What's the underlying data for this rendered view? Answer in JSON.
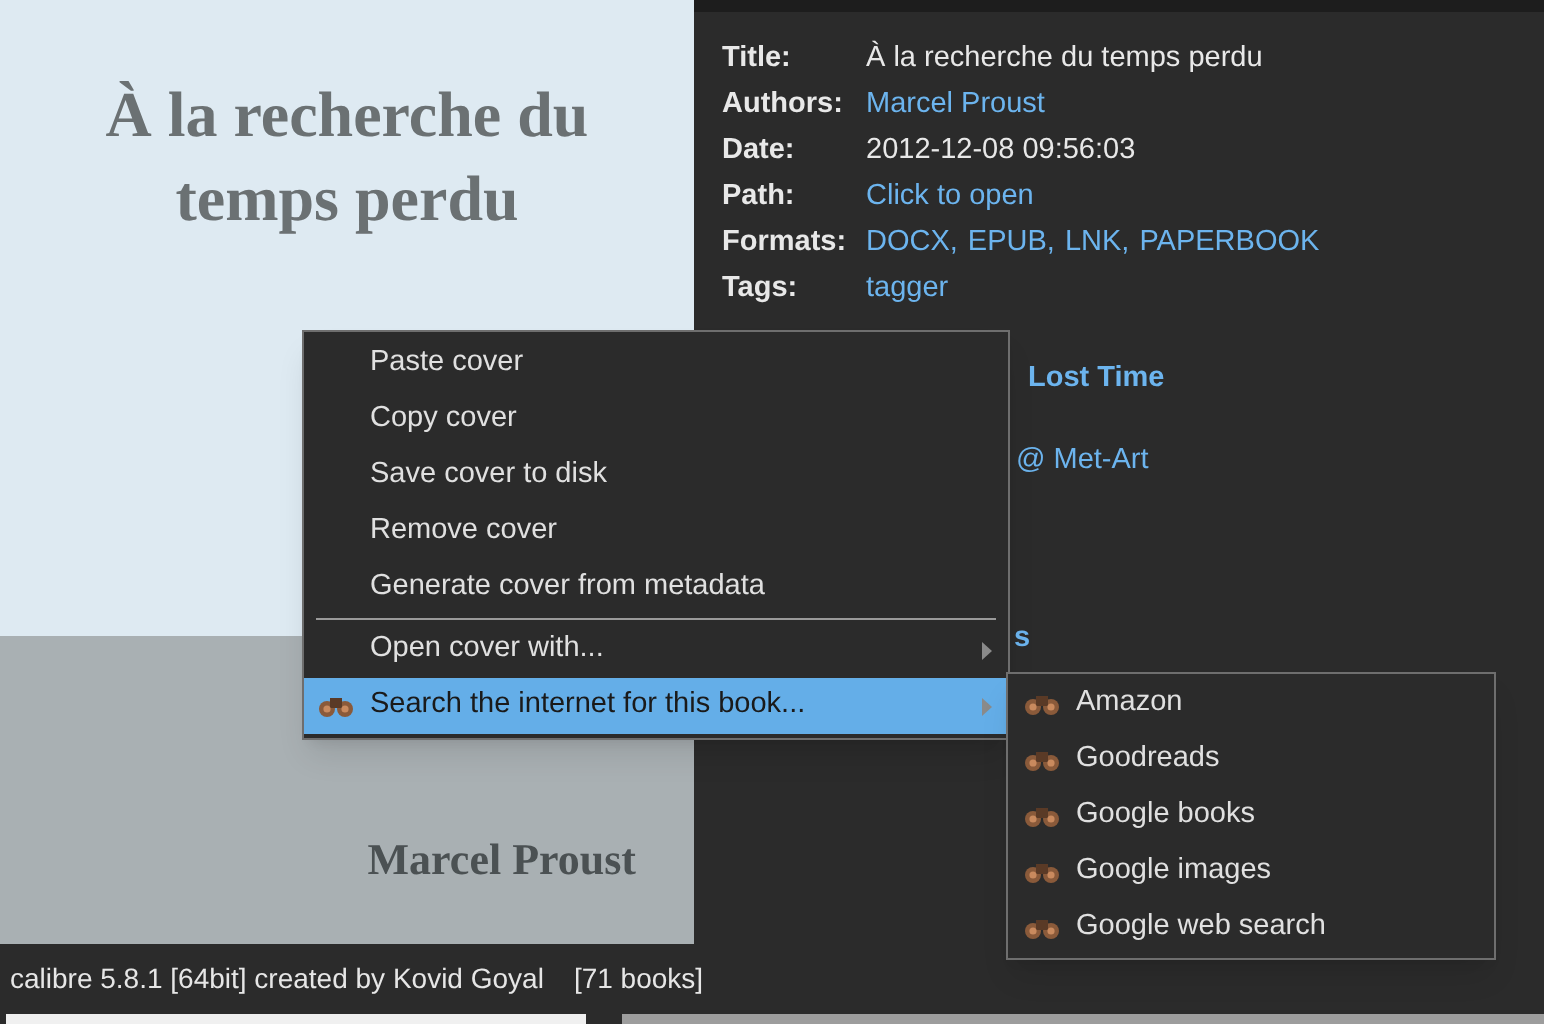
{
  "cover": {
    "title": "À la recherche du temps perdu",
    "author": "Marcel Proust"
  },
  "metadata": [
    {
      "label": "Title:",
      "kind": "text",
      "values": [
        "À la recherche du temps perdu"
      ]
    },
    {
      "label": "Authors:",
      "kind": "link",
      "values": [
        "Marcel Proust"
      ]
    },
    {
      "label": "Date:",
      "kind": "text",
      "values": [
        "2012-12-08 09:56:03"
      ]
    },
    {
      "label": "Path:",
      "kind": "link",
      "values": [
        "Click to open"
      ]
    },
    {
      "label": "Formats:",
      "kind": "link",
      "values": [
        "DOCX,",
        "EPUB,",
        "LNK,",
        "PAPERBOOK"
      ]
    },
    {
      "label": "Tags:",
      "kind": "link",
      "values": [
        "tagger"
      ]
    }
  ],
  "fragments": [
    {
      "text": "Lost Time",
      "kind": "heading"
    },
    {
      "text": "@ Met-Art",
      "kind": "link"
    },
    {
      "text": "s",
      "kind": "heading"
    }
  ],
  "context_menu": {
    "items": [
      {
        "label": "Paste cover",
        "kind": "item",
        "selected": false
      },
      {
        "label": "Copy cover",
        "kind": "item",
        "selected": false
      },
      {
        "label": "Save cover to disk",
        "kind": "item",
        "selected": false
      },
      {
        "label": "Remove cover",
        "kind": "item",
        "selected": false
      },
      {
        "label": "Generate cover from metadata",
        "kind": "item",
        "selected": false
      },
      {
        "kind": "separator"
      },
      {
        "label": "Open cover with...",
        "kind": "submenu",
        "selected": false
      },
      {
        "label": "Search the internet for this book...",
        "kind": "submenu",
        "selected": true,
        "icon": true
      }
    ],
    "submenu": [
      "Amazon",
      "Goodreads",
      "Google books",
      "Google images",
      "Google web search"
    ]
  },
  "status_bar": {
    "text": "calibre 5.8.1 [64bit] created by Kovid Goyal",
    "count": "[71 books]"
  }
}
